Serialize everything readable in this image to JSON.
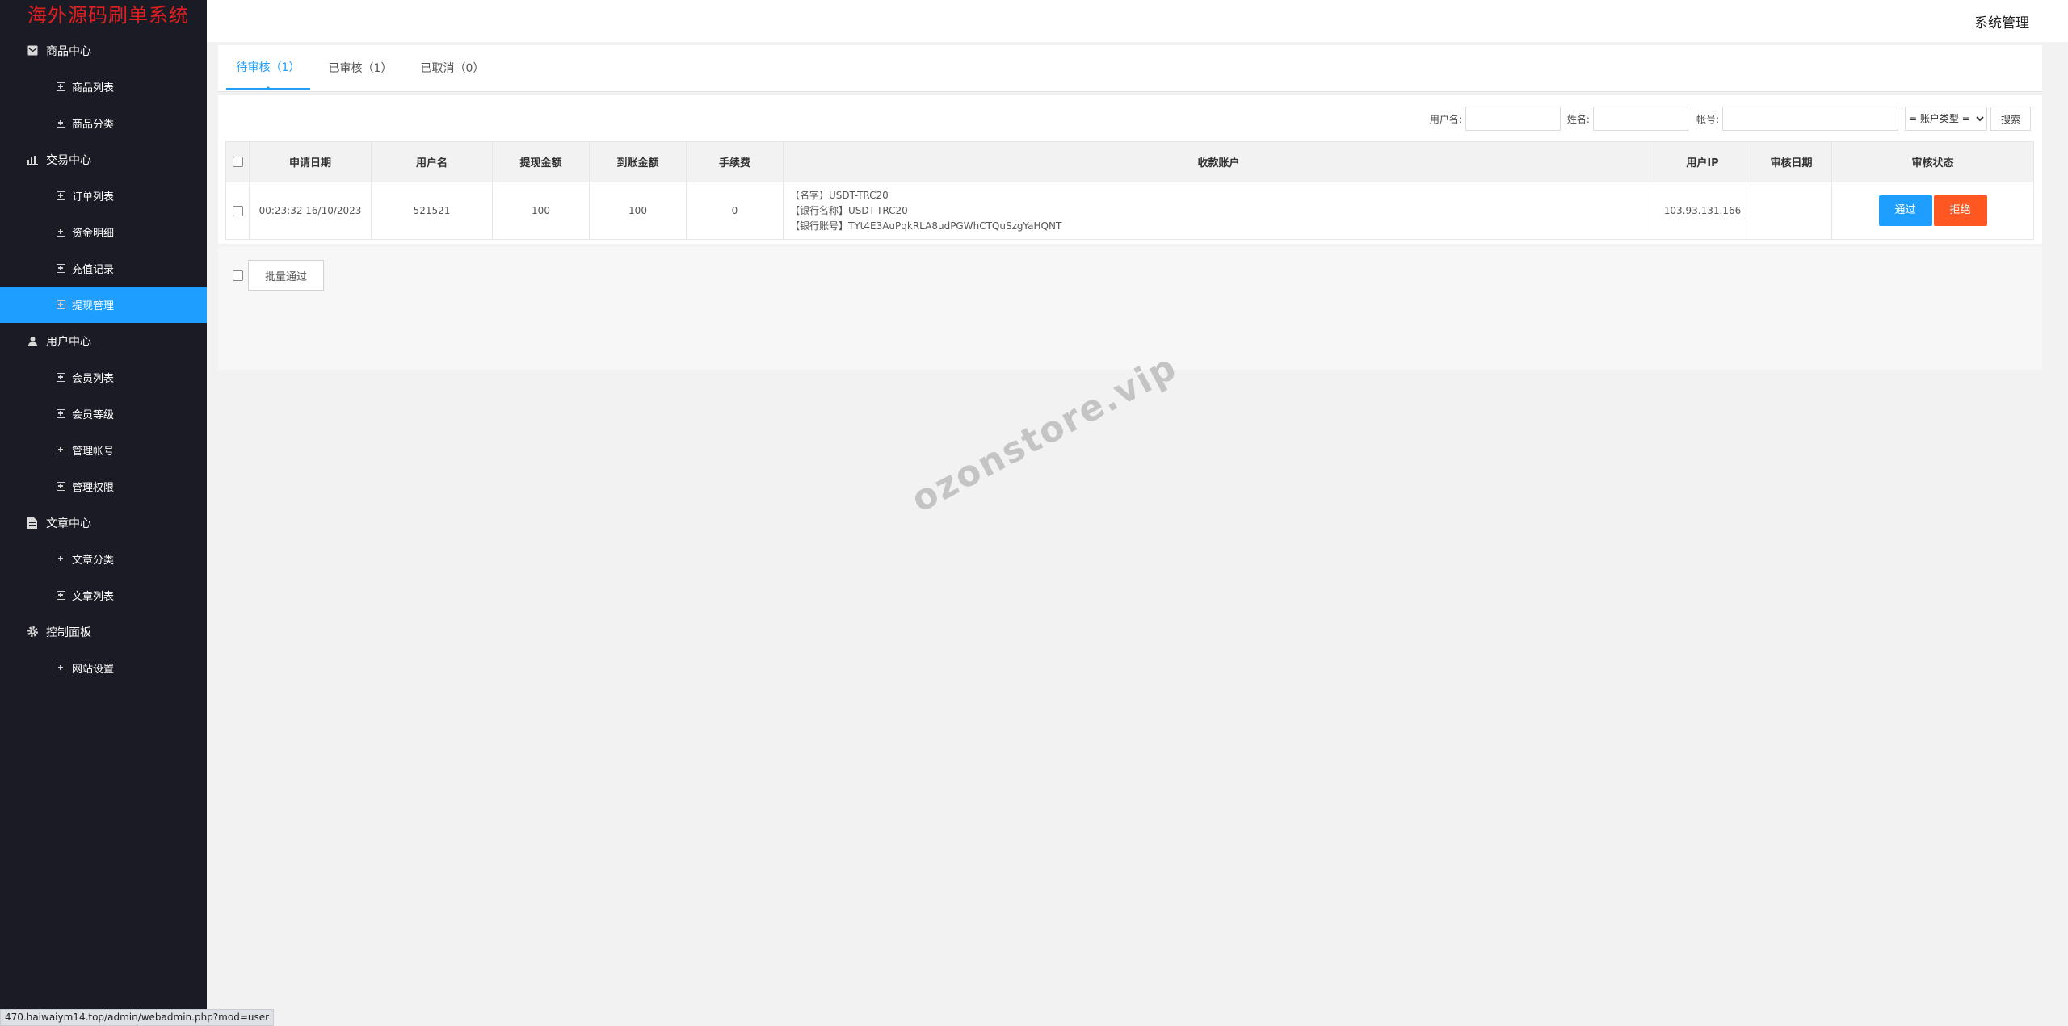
{
  "sidebar": {
    "logo": "海外源码刷单系统",
    "groups": [
      {
        "label": "商品中心",
        "icon": "mail-icon",
        "items": [
          "商品列表",
          "商品分类"
        ]
      },
      {
        "label": "交易中心",
        "icon": "bar-chart-icon",
        "items": [
          "订单列表",
          "资金明细",
          "充值记录",
          "提现管理"
        ]
      },
      {
        "label": "用户中心",
        "icon": "user-icon",
        "items": [
          "会员列表",
          "会员等级",
          "管理帐号",
          "管理权限"
        ]
      },
      {
        "label": "文章中心",
        "icon": "document-icon",
        "items": [
          "文章分类",
          "文章列表"
        ]
      },
      {
        "label": "控制面板",
        "icon": "gear-icon",
        "items": [
          "网站设置"
        ]
      }
    ],
    "active_item": "提现管理"
  },
  "header": {
    "system_label": "系统管理"
  },
  "tabs": [
    {
      "label": "待审核（1）",
      "active": true
    },
    {
      "label": "已审核（1）",
      "active": false
    },
    {
      "label": "已取消（0）",
      "active": false
    }
  ],
  "filter": {
    "username_label": "用户名:",
    "name_label": "姓名:",
    "account_label": "帐号:",
    "account_type_selected": "= 账户类型 =",
    "search_label": "搜索"
  },
  "table": {
    "columns": [
      "申请日期",
      "用户名",
      "提现金额",
      "到账金额",
      "手续费",
      "收款账户",
      "用户IP",
      "审核日期",
      "审核状态"
    ],
    "rows": [
      {
        "date": "00:23:32 16/10/2023",
        "username": "521521",
        "amount": "100",
        "received": "100",
        "fee": "0",
        "account_lines": [
          "【名字】USDT-TRC20",
          "【银行名称】USDT-TRC20",
          "【银行账号】TYt4E3AuPqkRLA8udPGWhCTQuSzgYaHQNT"
        ],
        "ip": "103.93.131.166",
        "review_date": "",
        "approve_label": "通过",
        "reject_label": "拒绝"
      }
    ]
  },
  "batch_approve_label": "批量通过",
  "watermark": "ozonstore.vip",
  "status_url": "470.haiwaiym14.top/admin/webadmin.php?mod=user",
  "colors": {
    "accent": "#1e9fff",
    "danger": "#ff5722",
    "sidebar_bg": "#1b1b26",
    "logo": "#e02020"
  }
}
